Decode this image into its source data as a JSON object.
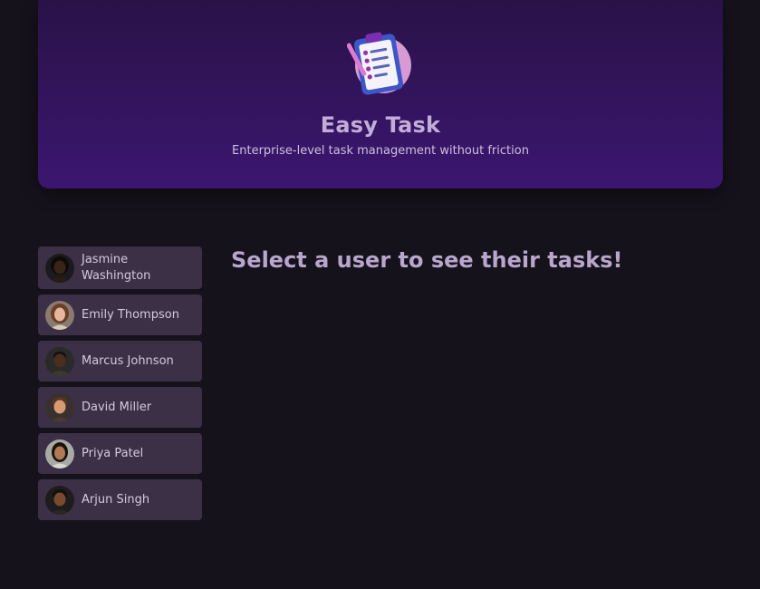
{
  "header": {
    "title": "Easy Task",
    "subtitle": "Enterprise-level task management without friction",
    "logo_icon": "clipboard-checklist-icon"
  },
  "users": [
    {
      "name": "Jasmine Washington",
      "skin": "#3a2418",
      "hair": "#0e0a08",
      "bg": "#1c1a1e"
    },
    {
      "name": "Emily Thompson",
      "skin": "#e6b79a",
      "hair": "#6a3f28",
      "bg": "#8a7a70"
    },
    {
      "name": "Marcus Johnson",
      "skin": "#4a2e1e",
      "hair": "#151010",
      "bg": "#2a2a2a"
    },
    {
      "name": "David Miller",
      "skin": "#d89a72",
      "hair": "#5a3420",
      "bg": "#3a3030"
    },
    {
      "name": "Priya Patel",
      "skin": "#b07a56",
      "hair": "#1c120c",
      "bg": "#a8aaa4"
    },
    {
      "name": "Arjun Singh",
      "skin": "#7a4a30",
      "hair": "#121010",
      "bg": "#1e1c1c"
    }
  ],
  "main": {
    "prompt": "Select a user to see their tasks!"
  },
  "colors": {
    "background": "#16121c",
    "header_gradient_top": "#2a1248",
    "header_gradient_bottom": "#3b1670",
    "user_item_bg": "#3b3046",
    "prompt_text": "#b8a6cc"
  }
}
